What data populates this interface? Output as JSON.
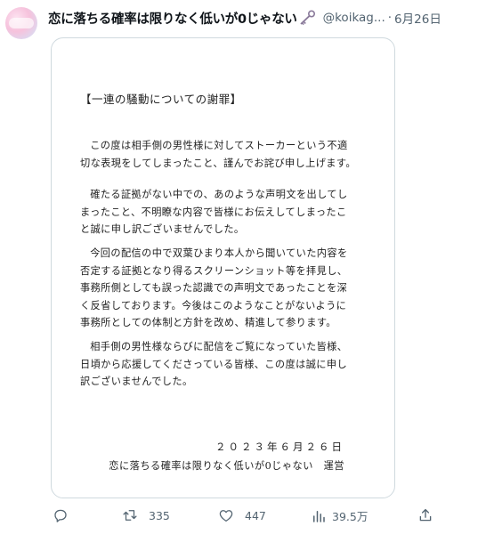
{
  "post": {
    "author_name": "恋に落ちる確率は限りなく低いが0じゃない",
    "handle": "@koikag...",
    "separator": "·",
    "date": "6月26日"
  },
  "document": {
    "title": "【一連の騒動についての謝罪】",
    "paragraphs": [
      "この度は相手側の男性様に対してストーカーという不適切な表現をしてしまったこと、謹んでお詫び申し上げます。",
      "確たる証拠がない中での、あのような声明文を出してしまったこと、不明瞭な内容で皆様にお伝えしてしまったこと誠に申し訳ございませんでした。",
      "今回の配信の中で双葉ひまり本人から聞いていた内容を否定する証拠となり得るスクリーンショット等を拝見し、事務所側としても誤った認識での声明文であったことを深く反省しております。今後はこのようなことがないように事務所としての体制と方針を改め、精進して参ります。",
      "相手側の男性様ならびに配信をご覧になっていた皆様、日頃から応援してくださっている皆様、この度は誠に申し訳ございませんでした。"
    ],
    "date": "２０２３年６月２６日",
    "signature": "恋に落ちる確率は限りなく低いが0じゃない　運営"
  },
  "actions": {
    "reply_count": "",
    "retweet_count": "335",
    "like_count": "447",
    "view_count": "39.5万"
  },
  "colors": {
    "text_primary": "#0f1419",
    "text_secondary": "#536471",
    "border": "#cfd9de"
  }
}
